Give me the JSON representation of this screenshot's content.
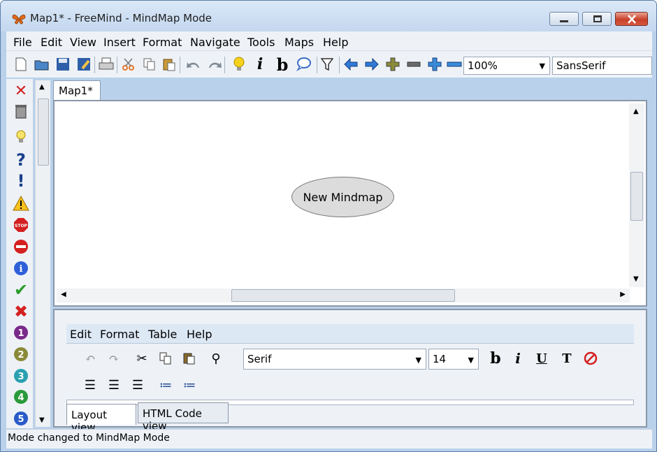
{
  "window": {
    "title": "Map1* - FreeMind - MindMap Mode"
  },
  "menubar": {
    "items": [
      "File",
      "Edit",
      "View",
      "Insert",
      "Format",
      "Navigate",
      "Tools",
      "Maps",
      "Help"
    ]
  },
  "toolbar": {
    "zoom": "100%",
    "font": "SansSerif"
  },
  "tabs": {
    "active": "Map1*"
  },
  "map": {
    "root_node": "New Mindmap"
  },
  "editor": {
    "menubar": [
      "Edit",
      "Format",
      "Table",
      "Help"
    ],
    "font": "Serif",
    "size": "14",
    "view_tabs": [
      "Layout view",
      "HTML Code view"
    ]
  },
  "status": {
    "text": "Mode changed to MindMap Mode"
  },
  "colors": {
    "title_bg": "#c3d7ef",
    "panel_bg": "#eef2f7",
    "node_bg": "#dcdcdc",
    "close_red": "#c8402a"
  }
}
